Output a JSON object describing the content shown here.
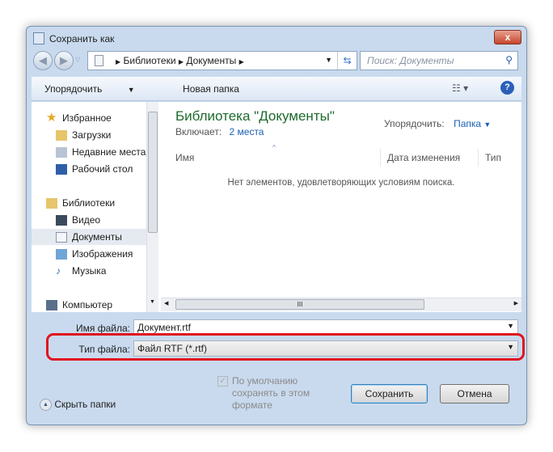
{
  "title": "Сохранить как",
  "breadcrumb": [
    "Библиотеки",
    "Документы"
  ],
  "search_placeholder": "Поиск: Документы",
  "toolbar": {
    "organize": "Упорядочить",
    "new_folder": "Новая папка"
  },
  "sidebar": {
    "favorites": "Избранное",
    "items": [
      {
        "label": "Загрузки"
      },
      {
        "label": "Недавние места"
      },
      {
        "label": "Рабочий стол"
      }
    ],
    "libraries": "Библиотеки",
    "lib_items": [
      {
        "label": "Видео"
      },
      {
        "label": "Документы"
      },
      {
        "label": "Изображения"
      },
      {
        "label": "Музыка"
      }
    ],
    "computer": "Компьютер"
  },
  "pane": {
    "title": "Библиотека \"Документы\"",
    "includes_label": "Включает:",
    "includes_value": "2 места",
    "arrange_label": "Упорядочить:",
    "arrange_value": "Папка",
    "columns": [
      "Имя",
      "Дата изменения",
      "Тип"
    ],
    "empty": "Нет элементов, удовлетворяющих условиям поиска."
  },
  "filename": {
    "label": "Имя файла:",
    "value": "Документ.rtf"
  },
  "filetype": {
    "label": "Тип файла:",
    "value": "Файл RTF (*.rtf)"
  },
  "checkbox": {
    "label": "По умолчанию сохранять в этом формате",
    "checked": true
  },
  "hide_folders": "Скрыть папки",
  "save": "Сохранить",
  "cancel": "Отмена",
  "highlight_color": "#e0141e"
}
